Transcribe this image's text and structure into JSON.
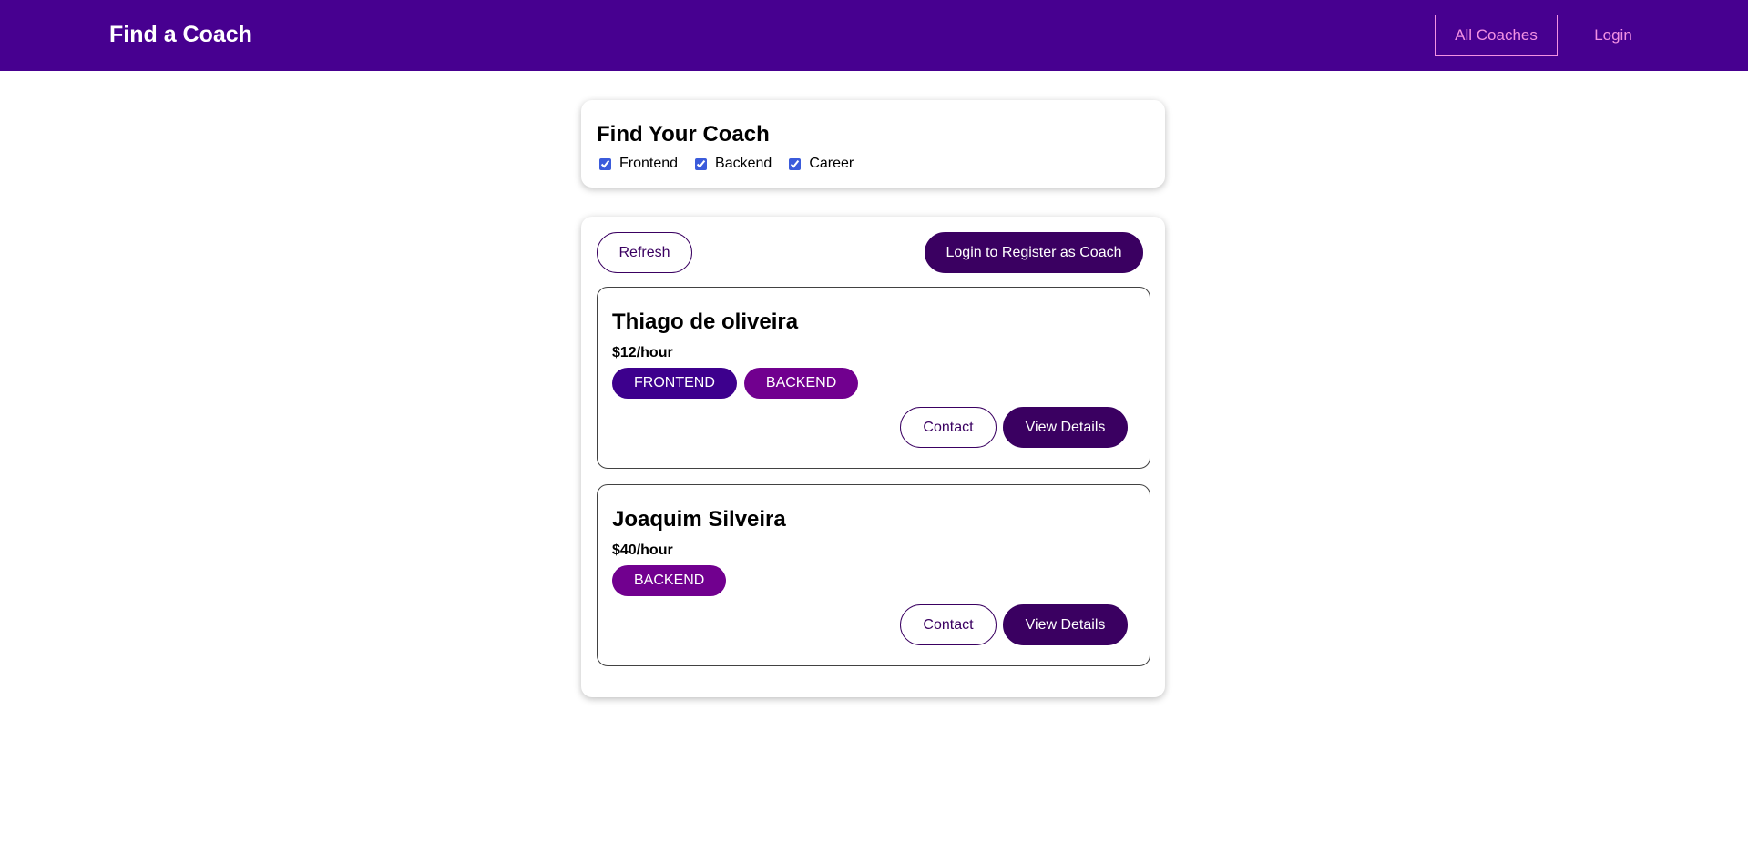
{
  "header": {
    "brand": "Find a Coach",
    "nav": {
      "all_coaches": "All Coaches",
      "login": "Login"
    },
    "background_color": "#470090",
    "link_color": "#f391e3"
  },
  "filter": {
    "title": "Find Your Coach",
    "options": [
      {
        "label": "Frontend",
        "checked": true
      },
      {
        "label": "Backend",
        "checked": true
      },
      {
        "label": "Career",
        "checked": true
      }
    ]
  },
  "controls": {
    "refresh_label": "Refresh",
    "register_label": "Login to Register as Coach"
  },
  "coaches": [
    {
      "name": "Thiago de oliveira",
      "rate": "$12/hour",
      "areas": [
        "FRONTEND",
        "BACKEND"
      ],
      "contact_label": "Contact",
      "details_label": "View Details"
    },
    {
      "name": "Joaquim Silveira",
      "rate": "$40/hour",
      "areas": [
        "BACKEND"
      ],
      "contact_label": "Contact",
      "details_label": "View Details"
    }
  ],
  "colors": {
    "primary": "#3a0061",
    "frontend_badge": "#3d008d",
    "backend_badge": "#71008f"
  }
}
